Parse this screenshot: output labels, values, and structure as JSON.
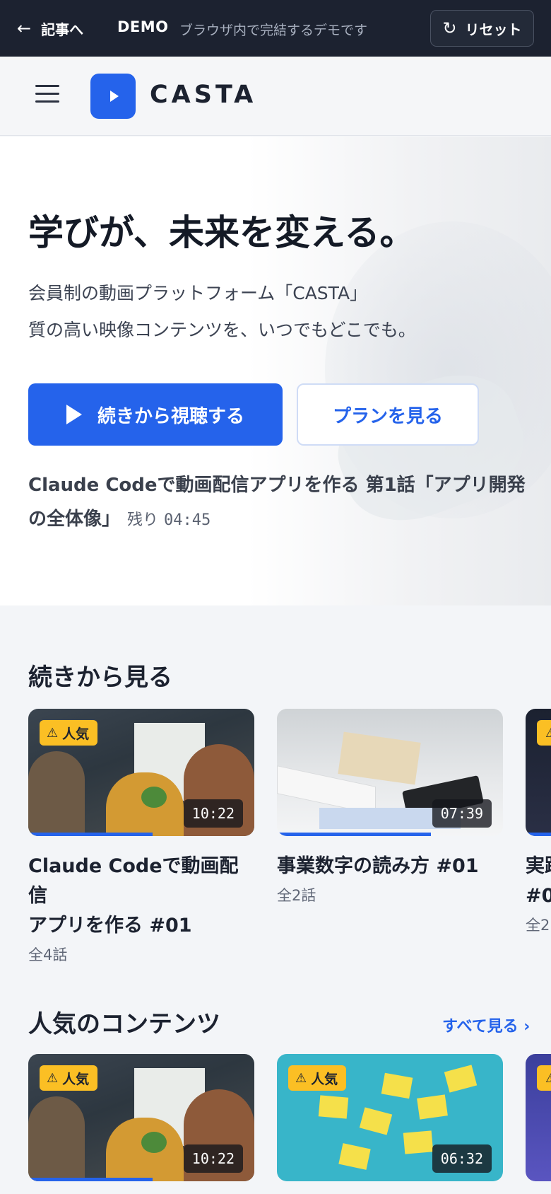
{
  "demo_bar": {
    "back_label": "記事へ",
    "back_icon": "arrow-left-icon",
    "tag": "DEMO",
    "note": "ブラウザ内で完結するデモです",
    "reset_label": "リセット",
    "reset_icon": "reset-icon"
  },
  "header": {
    "brand": "CASTA",
    "menu_icon": "hamburger-menu-icon",
    "accent_color": "#2563eb"
  },
  "hero": {
    "title": "学びが、未来を変える。",
    "subtitle_line1": "会員制の動画プラットフォーム「CASTA」",
    "subtitle_line2": "質の高い映像コンテンツを、いつでもどこでも。",
    "primary_button": "続きから視聴する",
    "secondary_button": "プランを見る",
    "resume_line1": "Claude Codeで動画配信アプリを作る 第1話「アプリ開発",
    "resume_line2": "の全体像」",
    "remaining_label": "残り",
    "remaining_time": "04:45"
  },
  "continue_section": {
    "title": "続きから見る",
    "cards": [
      {
        "badge": "人気",
        "duration": "10:22",
        "progress": 0.55,
        "title_line1": "Claude Codeで動画配信",
        "title_line2": "アプリを作る #01",
        "meta": "全4話"
      },
      {
        "badge": "",
        "duration": "07:39",
        "progress": 0.68,
        "title_line1": "事業数字の読み方 #01",
        "title_line2": "",
        "meta": "全2話"
      },
      {
        "badge": "",
        "duration": "",
        "progress": 1.0,
        "title_line1": "実践",
        "title_line2": "#0",
        "meta": "全2"
      }
    ]
  },
  "popular_section": {
    "title": "人気のコンテンツ",
    "see_all": "すべて見る ›",
    "cards": [
      {
        "badge": "人気",
        "duration": "10:22",
        "progress": 0.55
      },
      {
        "badge": "人気",
        "duration": "06:32",
        "progress": 0
      }
    ]
  },
  "colors": {
    "badge": "#fbbf24",
    "dark_bar": "#1c2230"
  }
}
